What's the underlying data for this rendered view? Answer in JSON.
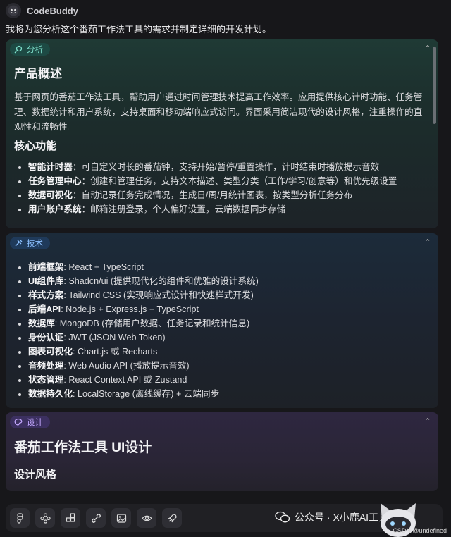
{
  "header": {
    "app_name": "CodeBuddy"
  },
  "intro": "我将为您分析这个番茄工作法工具的需求并制定详细的开发计划。",
  "analysis": {
    "tag": "分析",
    "title": "产品概述",
    "description": "基于网页的番茄工作法工具，帮助用户通过时间管理技术提高工作效率。应用提供核心计时功能、任务管理、数据统计和用户系统，支持桌面和移动端响应式访问。界面采用简洁现代的设计风格，注重操作的直观性和流畅性。",
    "features_title": "核心功能",
    "features": [
      {
        "label": "智能计时器",
        "text": "：可自定义时长的番茄钟，支持开始/暂停/重置操作，计时结束时播放提示音效"
      },
      {
        "label": "任务管理中心",
        "text": "：创建和管理任务，支持文本描述、类型分类（工作/学习/创意等）和优先级设置"
      },
      {
        "label": "数据可视化",
        "text": "：自动记录任务完成情况，生成日/周/月统计图表，按类型分析任务分布"
      },
      {
        "label": "用户账户系统",
        "text": "：邮箱注册登录，个人偏好设置，云端数据同步存储"
      }
    ]
  },
  "tech": {
    "tag": "技术",
    "items": [
      {
        "label": "前端框架",
        "text": ": React + TypeScript"
      },
      {
        "label": "UI组件库",
        "text": ": Shadcn/ui (提供现代化的组件和优雅的设计系统)"
      },
      {
        "label": "样式方案",
        "text": ": Tailwind CSS (实现响应式设计和快速样式开发)"
      },
      {
        "label": "后端API",
        "text": ": Node.js + Express.js + TypeScript"
      },
      {
        "label": "数据库",
        "text": ": MongoDB (存储用户数据、任务记录和统计信息)"
      },
      {
        "label": "身份认证",
        "text": ": JWT (JSON Web Token)"
      },
      {
        "label": "图表可视化",
        "text": ": Chart.js 或 Recharts"
      },
      {
        "label": "音频处理",
        "text": ": Web Audio API (播放提示音效)"
      },
      {
        "label": "状态管理",
        "text": ": React Context API 或 Zustand"
      },
      {
        "label": "数据持久化",
        "text": ": LocalStorage (离线缓存) + 云端同步"
      }
    ]
  },
  "design": {
    "tag": "设计",
    "title": "番茄工作法工具 UI设计",
    "subtitle": "设计风格"
  },
  "toolbar": {
    "buttons": [
      "figma-icon",
      "components-icon",
      "blocks-icon",
      "link-icon",
      "image-icon",
      "preview-eye-icon",
      "rocket-icon"
    ]
  },
  "watermark": {
    "text": "公众号 · X小鹿AI工具库",
    "csdn": "CSDN @undefined"
  },
  "colors": {
    "bg": "#17171a",
    "analysis_accent": "#7fe0cc",
    "tech_accent": "#8cc0ff",
    "design_accent": "#c4a8ff"
  }
}
